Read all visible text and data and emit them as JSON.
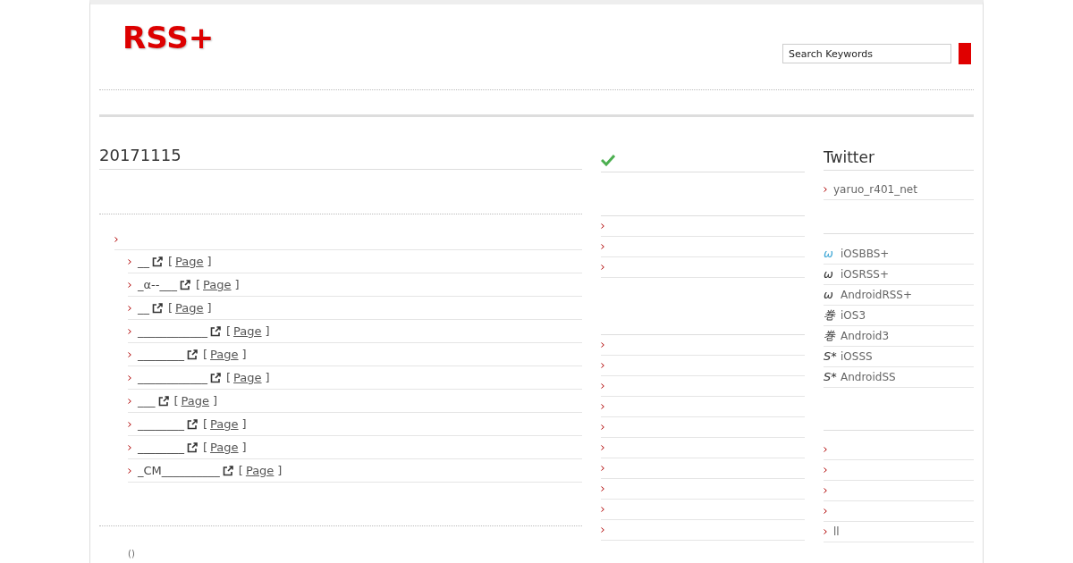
{
  "header": {
    "logo": "RSS+",
    "search": {
      "placeholder": "Search Keywords"
    }
  },
  "main": {
    "title": "20171115",
    "group": {
      "kind": "link",
      "children": [
        {
          "title": "__",
          "open": "[",
          "page": "Page",
          "close": "]"
        },
        {
          "title": "_α--___",
          "open": "[",
          "page": "Page",
          "close": "]"
        },
        {
          "title": "__",
          "open": "[",
          "page": "Page",
          "close": "]"
        },
        {
          "title": "____________",
          "open": "[",
          "page": "Page",
          "close": "]"
        },
        {
          "title": "________",
          "open": "[",
          "page": "Page",
          "close": "]"
        },
        {
          "title": "____________",
          "open": "[",
          "page": "Page",
          "close": "]"
        },
        {
          "title": "___",
          "open": "[",
          "page": "Page",
          "close": "]"
        },
        {
          "title": "________",
          "open": "[",
          "page": "Page",
          "close": "]"
        },
        {
          "title": "________",
          "open": "[",
          "page": "Page",
          "close": "]"
        },
        {
          "title": "_CM__________",
          "open": "[",
          "page": "Page",
          "close": "]"
        }
      ]
    },
    "footer_item": "()"
  },
  "middle": {
    "sections": [
      {
        "items": [
          {
            "kind": "link"
          },
          {
            "kind": "link"
          },
          {
            "kind": "link"
          }
        ]
      },
      {
        "items": [
          {
            "kind": "link"
          },
          {
            "kind": "link"
          },
          {
            "kind": "link"
          },
          {
            "kind": "link"
          },
          {
            "kind": "link"
          },
          {
            "kind": "link"
          },
          {
            "kind": "link"
          },
          {
            "kind": "link"
          },
          {
            "kind": "link"
          },
          {
            "kind": "link"
          }
        ]
      }
    ]
  },
  "sidebar": {
    "title": "Twitter",
    "twitter": [
      {
        "label": "yaruo_r401_net"
      }
    ],
    "apps": [
      {
        "mark": "ω",
        "label": "iOSBBS+",
        "color": "#3fa7d6"
      },
      {
        "mark": "ω",
        "label": "iOSRSS+",
        "color": "#333333"
      },
      {
        "mark": "ω",
        "label": "AndroidRSS+",
        "color": "#333333"
      },
      {
        "mark": "巻",
        "label": "iOS3",
        "color": "#333333"
      },
      {
        "mark": "巻",
        "label": "Android3",
        "color": "#333333"
      },
      {
        "mark": "S*",
        "label": "iOSSS",
        "color": "#333333"
      },
      {
        "mark": "S*",
        "label": "AndroidSS",
        "color": "#333333"
      }
    ],
    "links": [
      {
        "kind": "link"
      },
      {
        "kind": "link"
      },
      {
        "kind": "link"
      },
      {
        "kind": "link"
      },
      {
        "kind": "text",
        "label": "ll"
      }
    ]
  }
}
